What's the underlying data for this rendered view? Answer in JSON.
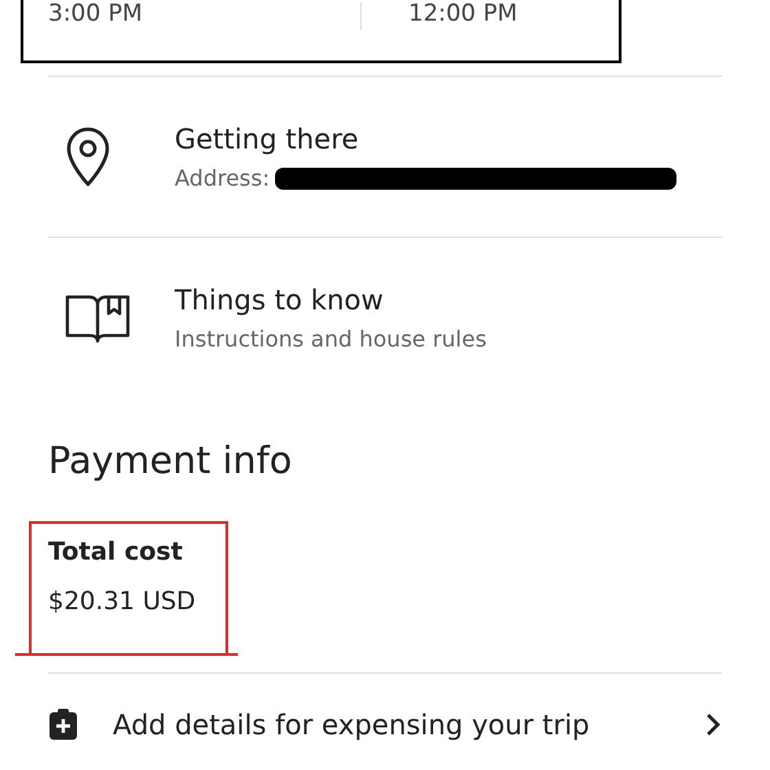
{
  "times": [
    "3:00 PM",
    "12:00 PM"
  ],
  "sections": [
    {
      "kind": "location",
      "title": "Getting there",
      "subtitle": "Address:",
      "redacted": true
    },
    {
      "kind": "book",
      "title": "Things to know",
      "subtitle": "Instructions and house rules",
      "redacted": false
    }
  ],
  "payment": {
    "heading": "Payment info",
    "total_label": "Total cost",
    "total_value": "$20.31 USD"
  },
  "expense_link": {
    "label": "Add details for expensing your trip"
  }
}
